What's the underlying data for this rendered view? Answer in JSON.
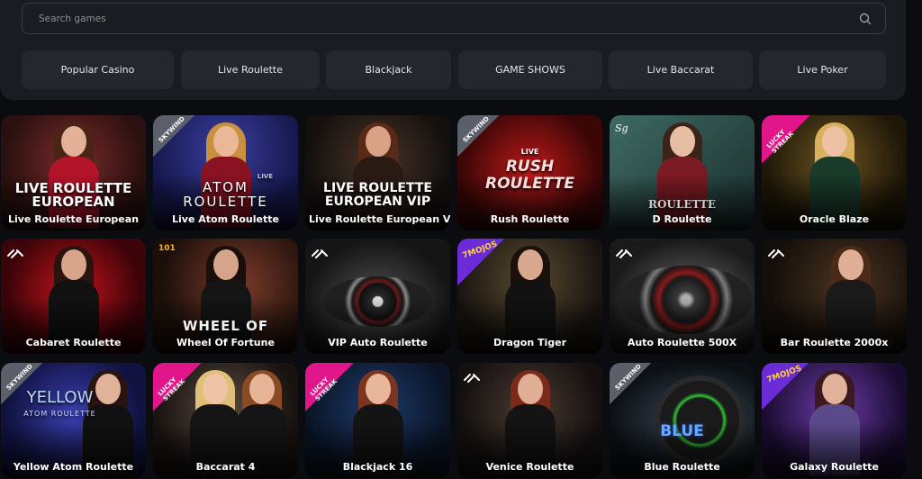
{
  "search": {
    "placeholder": "Search games",
    "value": ""
  },
  "categories": [
    {
      "label": "Popular Casino"
    },
    {
      "label": "Live Roulette"
    },
    {
      "label": "Blackjack"
    },
    {
      "label": "GAME SHOWS"
    },
    {
      "label": "Live Baccarat"
    },
    {
      "label": "Live Poker"
    }
  ],
  "games": [
    {
      "name": "Live Roulette European",
      "overlay": "LIVE ROULETTE EUROPEAN"
    },
    {
      "name": "Live Atom Roulette",
      "provider": "SKYWIND",
      "overlay_small": "LIVE",
      "overlay": "ATOM ROULETTE"
    },
    {
      "name": "Live Roulette European VIP",
      "overlay": "LIVE ROULETTE EUROPEAN VIP"
    },
    {
      "name": "Rush Roulette",
      "provider": "SKYWIND",
      "overlay_small": "LIVE",
      "overlay": "RUSH ROULETTE"
    },
    {
      "name": "D Roulette",
      "provider": "SG CASINO",
      "overlay": "ROULETTE"
    },
    {
      "name": "Oracle Blaze",
      "provider": "LUCKY STREAK"
    },
    {
      "name": "Cabaret Roulette"
    },
    {
      "name": "Wheel Of Fortune",
      "provider": "101",
      "overlay": "WHEEL OF"
    },
    {
      "name": "VIP Auto Roulette"
    },
    {
      "name": "Dragon Tiger",
      "provider": "7MOJOS"
    },
    {
      "name": "Auto Roulette 500X"
    },
    {
      "name": "Bar Roulette 2000x"
    },
    {
      "name": "Yellow Atom Roulette",
      "provider": "SKYWIND",
      "overlay": "YELLOW",
      "overlay_sub": "ATOM ROULETTE"
    },
    {
      "name": "Baccarat 4",
      "provider": "LUCKY STREAK"
    },
    {
      "name": "Blackjack 16",
      "provider": "LUCKY STREAK"
    },
    {
      "name": "Venice Roulette"
    },
    {
      "name": "Blue Roulette",
      "provider": "SKYWIND",
      "overlay": "BLUE"
    },
    {
      "name": "Galaxy Roulette",
      "provider": "7MOJOS"
    }
  ],
  "colors": {
    "panel": "#1a1c21",
    "button": "#24272d",
    "accent_pink": "#e2158a",
    "accent_purple": "#6b2bd6"
  }
}
